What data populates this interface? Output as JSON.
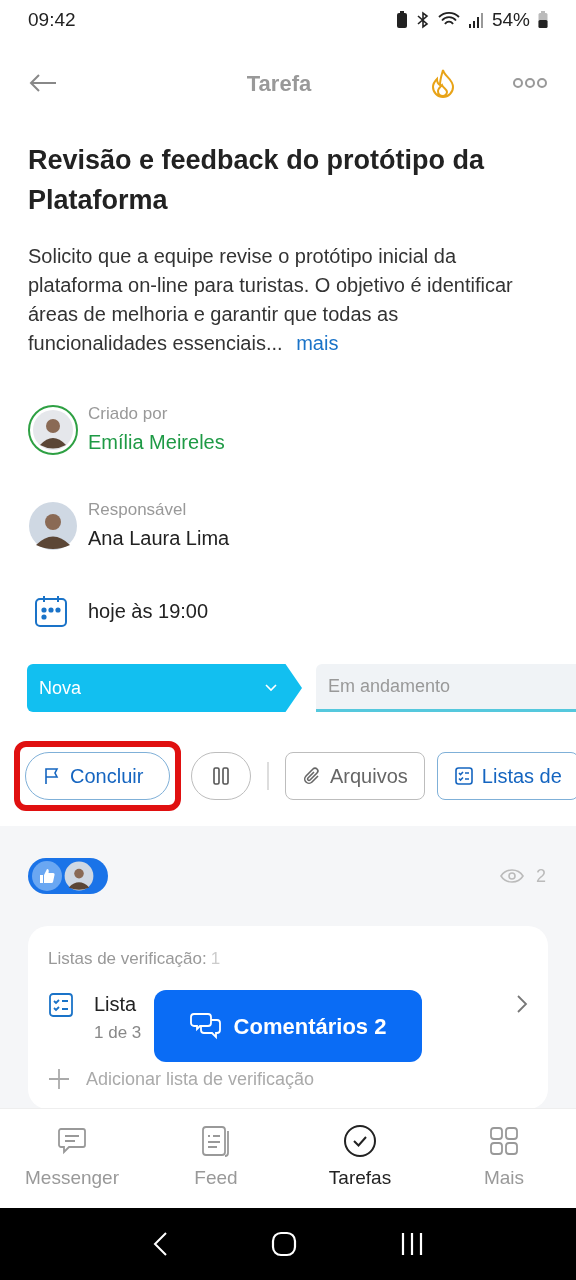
{
  "status_bar": {
    "time": "09:42",
    "battery": "54%"
  },
  "header": {
    "title": "Tarefa"
  },
  "task": {
    "title": "Revisão e feedback do protótipo da Plataforma",
    "description": "Solicito que a equipe revise o protótipo inicial da plataforma on-line para turistas. O objetivo é identificar áreas de melhoria e garantir que todas as funcionalidades essenciais...",
    "more_link": "mais"
  },
  "people": [
    {
      "label": "Criado por",
      "name": "Emília Meireles",
      "highlighted": true
    },
    {
      "label": "Responsável",
      "name": "Ana Laura Lima",
      "highlighted": false
    }
  ],
  "deadline": "hoje às 19:00",
  "stages": [
    {
      "label": "Nova",
      "selected": true
    },
    {
      "label": "Em andamento",
      "selected": false
    }
  ],
  "actions": [
    {
      "kind": "complete",
      "label": "Concluir",
      "highlighted": true
    },
    {
      "kind": "pause",
      "highlighted": false
    },
    {
      "kind": "files",
      "label": "Arquivos",
      "highlighted": false
    },
    {
      "kind": "checklists",
      "label": "Listas de",
      "highlighted": false
    }
  ],
  "views": "2",
  "checklists": {
    "heading": "Listas de verificação:",
    "count": "1",
    "items": [
      {
        "title": "Lista",
        "progress": "1 de 3"
      }
    ],
    "add_label": "Adicionar lista de verificação"
  },
  "comments_button": "Comentários 2",
  "nav": [
    {
      "label": "Messenger",
      "selected": false
    },
    {
      "label": "Feed",
      "selected": false
    },
    {
      "label": "Tarefas",
      "selected": true
    },
    {
      "label": "Mais",
      "selected": false
    }
  ]
}
